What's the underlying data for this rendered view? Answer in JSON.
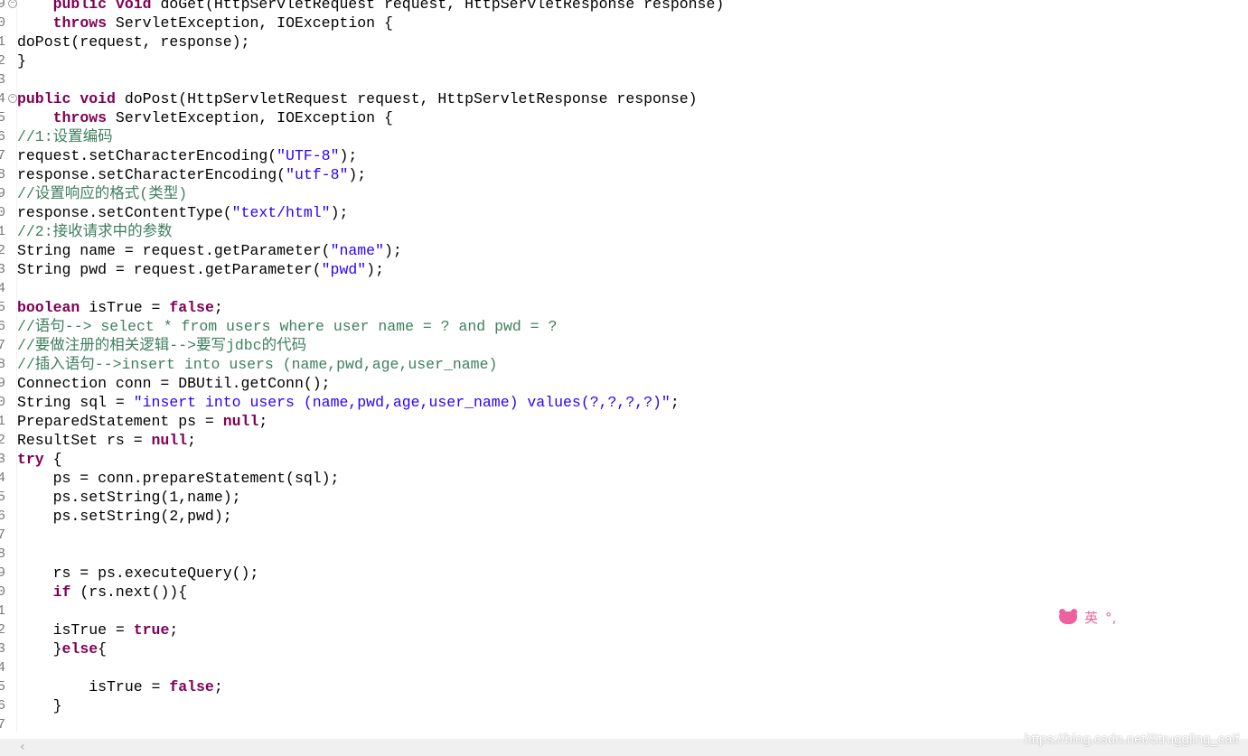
{
  "colors": {
    "keyword": "#7f0055",
    "string": "#2a00ff",
    "comment": "#3f7f5f",
    "ime": "#f0609e"
  },
  "lines": [
    {
      "n": "9",
      "fold": true,
      "t": [
        [
          "p",
          "    "
        ],
        [
          "kw",
          "public"
        ],
        [
          "p",
          " "
        ],
        [
          "kw",
          "void"
        ],
        [
          "p",
          " doGet(HttpServletRequest request, HttpServletResponse response)"
        ]
      ]
    },
    {
      "n": "0",
      "t": [
        [
          "p",
          "    "
        ],
        [
          "kw",
          "throws"
        ],
        [
          "p",
          " ServletException, IOException {"
        ]
      ]
    },
    {
      "n": "1",
      "t": [
        [
          "p",
          "doPost(request, response);"
        ]
      ]
    },
    {
      "n": "2",
      "t": [
        [
          "p",
          "}"
        ]
      ]
    },
    {
      "n": "3",
      "t": []
    },
    {
      "n": "4",
      "fold": true,
      "t": [
        [
          "kw",
          "public"
        ],
        [
          "p",
          " "
        ],
        [
          "kw",
          "void"
        ],
        [
          "p",
          " doPost(HttpServletRequest request, HttpServletResponse response)"
        ]
      ]
    },
    {
      "n": "5",
      "t": [
        [
          "p",
          "    "
        ],
        [
          "kw",
          "throws"
        ],
        [
          "p",
          " ServletException, IOException {"
        ]
      ]
    },
    {
      "n": "6",
      "t": [
        [
          "cm",
          "//1:设置编码"
        ]
      ]
    },
    {
      "n": "7",
      "t": [
        [
          "p",
          "request.setCharacterEncoding("
        ],
        [
          "str",
          "\"UTF-8\""
        ],
        [
          "p",
          ");"
        ]
      ]
    },
    {
      "n": "8",
      "t": [
        [
          "p",
          "response.setCharacterEncoding("
        ],
        [
          "str",
          "\"utf-8\""
        ],
        [
          "p",
          ");"
        ]
      ]
    },
    {
      "n": "9",
      "t": [
        [
          "cm",
          "//设置响应的格式(类型)"
        ]
      ]
    },
    {
      "n": "0",
      "t": [
        [
          "p",
          "response.setContentType("
        ],
        [
          "str",
          "\"text/html\""
        ],
        [
          "p",
          ");"
        ]
      ]
    },
    {
      "n": "1",
      "t": [
        [
          "cm",
          "//2:接收请求中的参数"
        ]
      ]
    },
    {
      "n": "2",
      "t": [
        [
          "p",
          "String name = request.getParameter("
        ],
        [
          "str",
          "\"name\""
        ],
        [
          "p",
          ");"
        ]
      ]
    },
    {
      "n": "3",
      "t": [
        [
          "p",
          "String pwd = request.getParameter("
        ],
        [
          "str",
          "\"pwd\""
        ],
        [
          "p",
          ");"
        ]
      ]
    },
    {
      "n": "4",
      "t": []
    },
    {
      "n": "5",
      "t": [
        [
          "kw",
          "boolean"
        ],
        [
          "p",
          " isTrue = "
        ],
        [
          "kw",
          "false"
        ],
        [
          "p",
          ";"
        ]
      ]
    },
    {
      "n": "6",
      "t": [
        [
          "cm",
          "//语句--> select * from users where user name = ? and pwd = ?"
        ]
      ]
    },
    {
      "n": "7",
      "t": [
        [
          "cm",
          "//要做注册的相关逻辑-->要写jdbc的代码"
        ]
      ]
    },
    {
      "n": "8",
      "t": [
        [
          "cm",
          "//插入语句-->insert into users (name,pwd,age,user_name)"
        ]
      ]
    },
    {
      "n": "9",
      "t": [
        [
          "p",
          "Connection conn = DBUtil.getConn();"
        ]
      ]
    },
    {
      "n": "0",
      "t": [
        [
          "p",
          "String sql = "
        ],
        [
          "str",
          "\"insert into users (name,pwd,age,user_name) values(?,?,?,?)\""
        ],
        [
          "p",
          ";"
        ]
      ]
    },
    {
      "n": "1",
      "t": [
        [
          "p",
          "PreparedStatement ps = "
        ],
        [
          "kw",
          "null"
        ],
        [
          "p",
          ";"
        ]
      ]
    },
    {
      "n": "2",
      "t": [
        [
          "p",
          "ResultSet rs = "
        ],
        [
          "kw",
          "null"
        ],
        [
          "p",
          ";"
        ]
      ]
    },
    {
      "n": "3",
      "t": [
        [
          "kw",
          "try"
        ],
        [
          "p",
          " {"
        ]
      ]
    },
    {
      "n": "4",
      "t": [
        [
          "p",
          "    ps = conn.prepareStatement(sql);"
        ]
      ]
    },
    {
      "n": "5",
      "t": [
        [
          "p",
          "    ps.setString(1,name);"
        ]
      ]
    },
    {
      "n": "6",
      "t": [
        [
          "p",
          "    ps.setString(2,pwd);"
        ]
      ]
    },
    {
      "n": "7",
      "t": []
    },
    {
      "n": "8",
      "t": []
    },
    {
      "n": "9",
      "t": [
        [
          "p",
          "    rs = ps.executeQuery();"
        ]
      ]
    },
    {
      "n": "0",
      "t": [
        [
          "p",
          "    "
        ],
        [
          "kw",
          "if"
        ],
        [
          "p",
          " (rs.next()){"
        ]
      ]
    },
    {
      "n": "1",
      "t": []
    },
    {
      "n": "2",
      "t": [
        [
          "p",
          "    isTrue = "
        ],
        [
          "kw",
          "true"
        ],
        [
          "p",
          ";"
        ]
      ]
    },
    {
      "n": "3",
      "t": [
        [
          "p",
          "    }"
        ],
        [
          "kw",
          "else"
        ],
        [
          "p",
          "{"
        ]
      ]
    },
    {
      "n": "4",
      "t": []
    },
    {
      "n": "5",
      "t": [
        [
          "p",
          "        isTrue = "
        ],
        [
          "kw",
          "false"
        ],
        [
          "p",
          ";"
        ]
      ]
    },
    {
      "n": "6",
      "t": [
        [
          "p",
          "    }"
        ]
      ]
    },
    {
      "n": "7",
      "t": []
    }
  ],
  "ime": {
    "icon": "bear-icon",
    "label": "英",
    "punct": "°,"
  },
  "watermark": "https://blog.csdn.net/Struggling_calf",
  "scrollbar": {
    "left_arrow": "‹"
  }
}
